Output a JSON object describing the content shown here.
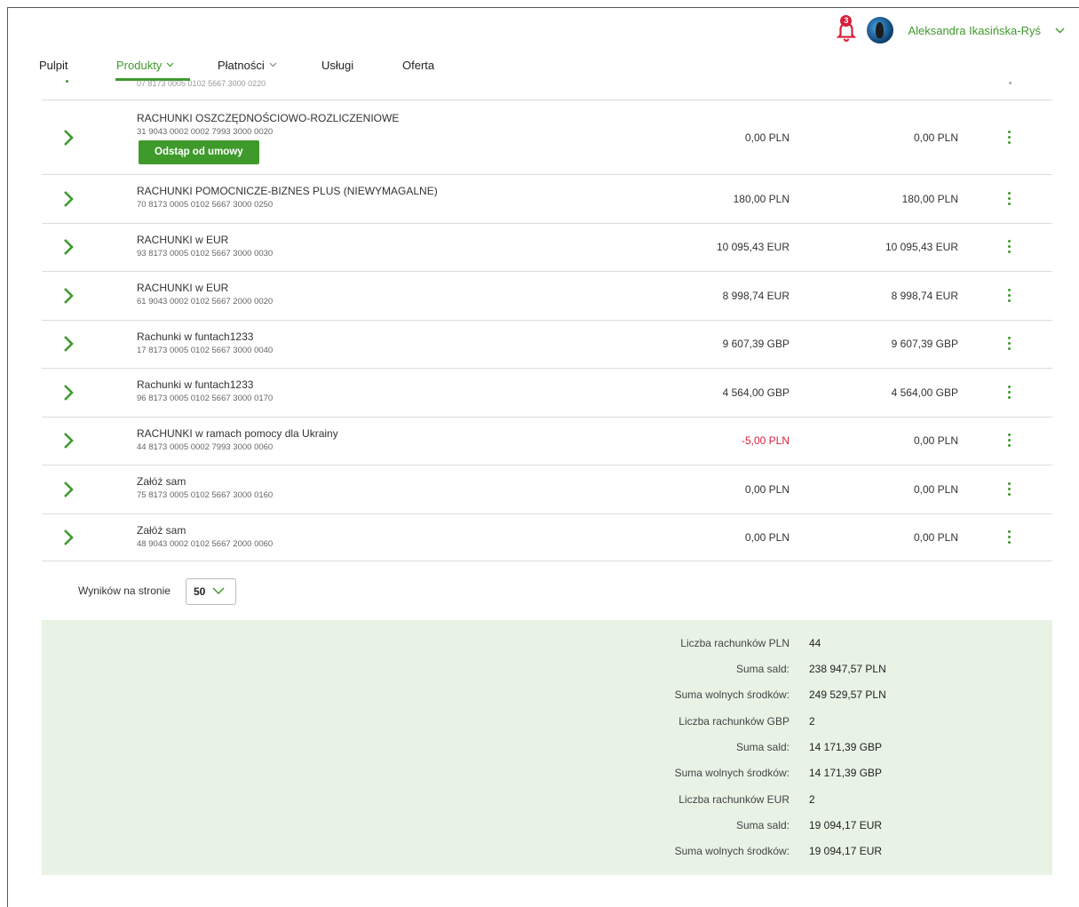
{
  "header": {
    "notifications_count": "3",
    "user_name": "Aleksandra Ikasińska-Ryś"
  },
  "nav": {
    "items": [
      {
        "label": "Pulpit",
        "has_dropdown": false
      },
      {
        "label": "Produkty",
        "has_dropdown": true,
        "active": true
      },
      {
        "label": "Płatności",
        "has_dropdown": true
      },
      {
        "label": "Usługi",
        "has_dropdown": false
      },
      {
        "label": "Oferta",
        "has_dropdown": false
      }
    ]
  },
  "cut_row": {
    "number": "07 8173 0005 0102 5667 3000 0220"
  },
  "accounts": [
    {
      "name": "RACHUNKI OSZCZĘDNOŚCIOWO-ROZLICZENIOWE",
      "number": "31 9043 0002 0002 7993 3000 0020",
      "balance": "0,00 PLN",
      "available": "0,00 PLN",
      "action": "Odstąp od umowy"
    },
    {
      "name": "RACHUNKI POMOCNICZE-BIZNES PLUS (NIEWYMAGALNE)",
      "number": "70 8173 0005 0102 5667 3000 0250",
      "balance": "180,00 PLN",
      "available": "180,00 PLN"
    },
    {
      "name": "RACHUNKI w EUR",
      "number": "93 8173 0005 0102 5667 3000 0030",
      "balance": "10 095,43 EUR",
      "available": "10 095,43 EUR"
    },
    {
      "name": "RACHUNKI w EUR",
      "number": "61 9043 0002 0102 5667 2000 0020",
      "balance": "8 998,74 EUR",
      "available": "8 998,74 EUR"
    },
    {
      "name": "Rachunki w funtach1233",
      "number": "17 8173 0005 0102 5667 3000 0040",
      "balance": "9 607,39 GBP",
      "available": "9 607,39 GBP"
    },
    {
      "name": "Rachunki w funtach1233",
      "number": "96 8173 0005 0102 5667 3000 0170",
      "balance": "4 564,00 GBP",
      "available": "4 564,00 GBP"
    },
    {
      "name": "RACHUNKI w ramach pomocy dla Ukrainy",
      "number": "44 8173 0005 0002 7993 3000 0060",
      "balance": "-5,00 PLN",
      "available": "0,00 PLN",
      "negative": true
    },
    {
      "name": "Załóż sam",
      "number": "75 8173 0005 0102 5667 3000 0160",
      "balance": "0,00 PLN",
      "available": "0,00 PLN"
    },
    {
      "name": "Załóż sam",
      "number": "48 9043 0002 0102 5667 2000 0060",
      "balance": "0,00 PLN",
      "available": "0,00 PLN"
    }
  ],
  "pager": {
    "label": "Wyników na stronie",
    "value": "50"
  },
  "summary": [
    {
      "label": "Liczba rachunków PLN",
      "value": "44"
    },
    {
      "label": "Suma sald:",
      "value": "238 947,57 PLN"
    },
    {
      "label": "Suma wolnych środków:",
      "value": "249 529,57 PLN"
    },
    {
      "label": "Liczba rachunków GBP",
      "value": "2"
    },
    {
      "label": "Suma sald:",
      "value": "14 171,39 GBP"
    },
    {
      "label": "Suma wolnych środków:",
      "value": "14 171,39 GBP"
    },
    {
      "label": "Liczba rachunków EUR",
      "value": "2"
    },
    {
      "label": "Suma sald:",
      "value": "19 094,17 EUR"
    },
    {
      "label": "Suma wolnych środków:",
      "value": "19 094,17 EUR"
    }
  ],
  "colors": {
    "accent": "#3e9a2b",
    "negative": "#d6203a",
    "summary_bg": "#e8f3e6"
  }
}
